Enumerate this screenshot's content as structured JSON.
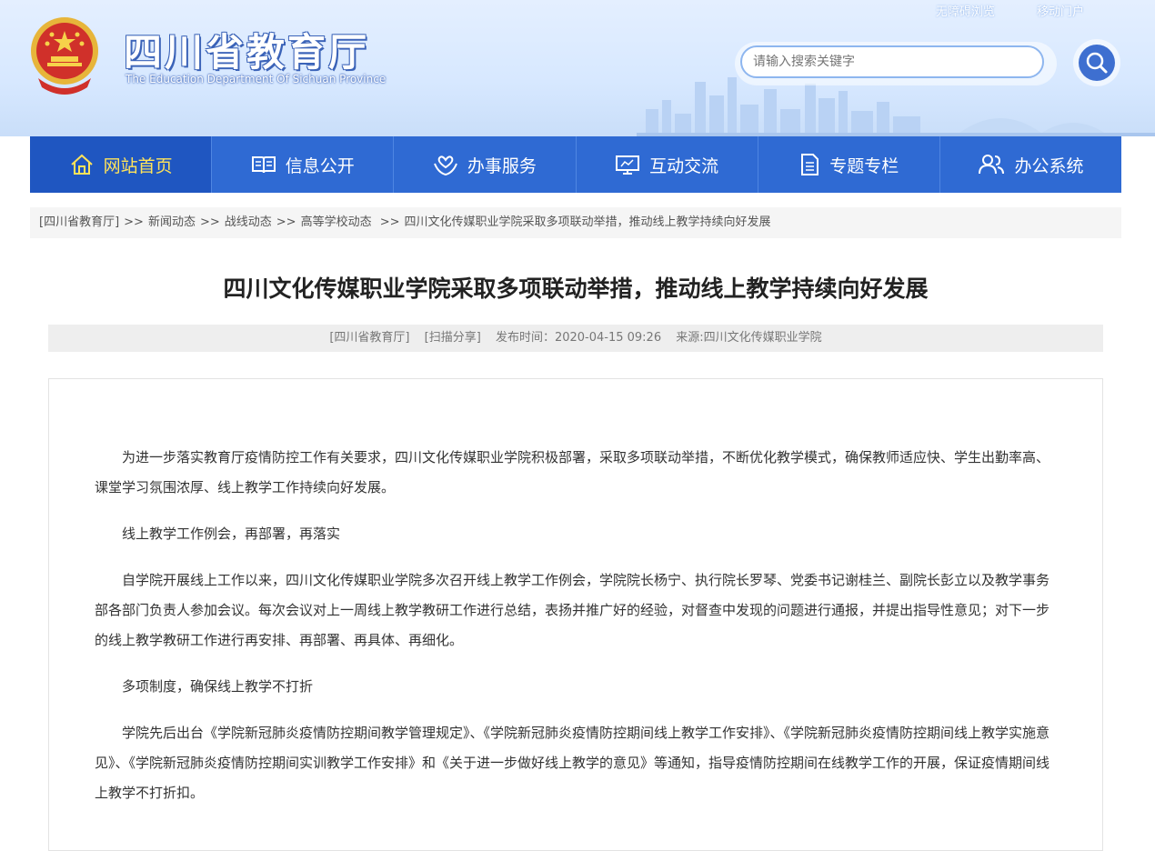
{
  "header": {
    "title": "四川省教育厅",
    "subtitle": "The Education Department Of Sichuan Province",
    "top_links": [
      "无障碍浏览",
      "移动门户"
    ],
    "search_placeholder": "请输入搜索关键字"
  },
  "nav": [
    {
      "label": "网站首页",
      "icon": "home-icon"
    },
    {
      "label": "信息公开",
      "icon": "book-icon"
    },
    {
      "label": "办事服务",
      "icon": "hands-icon"
    },
    {
      "label": "互动交流",
      "icon": "monitor-icon"
    },
    {
      "label": "专题专栏",
      "icon": "document-icon"
    },
    {
      "label": "办公系统",
      "icon": "users-icon"
    }
  ],
  "breadcrumb": [
    "[四川省教育厅]",
    "新闻动态",
    "战线动态",
    "高等学校动态",
    "四川文化传媒职业学院采取多项联动举措，推动线上教学持续向好发展"
  ],
  "breadcrumb_sep": ">>",
  "article": {
    "title": "四川文化传媒职业学院采取多项联动举措，推动线上教学持续向好发展",
    "meta_site": "[四川省教育厅]",
    "meta_share": "[扫描分享]",
    "meta_date": "发布时间：2020-04-15 09:26",
    "meta_source": "来源:四川文化传媒职业学院",
    "paragraphs": [
      "为进一步落实教育厅疫情防控工作有关要求，四川文化传媒职业学院积极部署，采取多项联动举措，不断优化教学模式，确保教师适应快、学生出勤率高、课堂学习氛围浓厚、线上教学工作持续向好发展。",
      "线上教学工作例会，再部署，再落实",
      "自学院开展线上工作以来，四川文化传媒职业学院多次召开线上教学工作例会，学院院长杨宁、执行院长罗琴、党委书记谢桂兰、副院长彭立以及教学事务部各部门负责人参加会议。每次会议对上一周线上教学教研工作进行总结，表扬并推广好的经验，对督查中发现的问题进行通报，并提出指导性意见；对下一步的线上教学教研工作进行再安排、再部署、再具体、再细化。",
      "多项制度，确保线上教学不打折",
      "学院先后出台《学院新冠肺炎疫情防控期间教学管理规定》、《学院新冠肺炎疫情防控期间线上教学工作安排》、《学院新冠肺炎疫情防控期间线上教学实施意见》、《学院新冠肺炎疫情防控期间实训教学工作安排》和《关于进一步做好线上教学的意见》等通知，指导疫情防控期间在线教学工作的开展，保证疫情期间线上教学不打折扣。"
    ]
  },
  "colors": {
    "nav_bg": "#2f6ad3",
    "nav_active_bg": "#1f56c1",
    "nav_active_text": "#ffe35a",
    "header_bg": "#d7e8ff"
  }
}
